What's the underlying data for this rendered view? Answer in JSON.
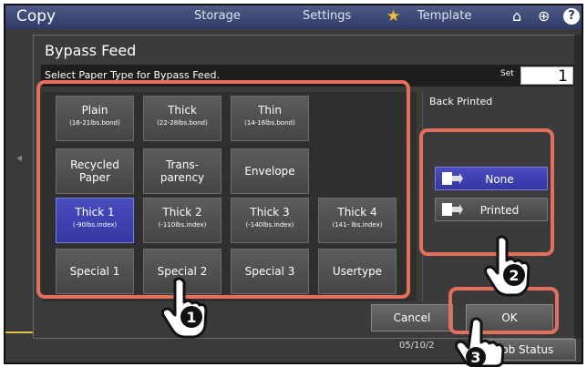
{
  "topbar": {
    "app_title": "Copy",
    "tabs": [
      "Storage",
      "Settings",
      "Template"
    ],
    "icons": [
      "star-icon",
      "home-icon",
      "globe-icon",
      "help-icon"
    ]
  },
  "dialog": {
    "title": "Bypass Feed",
    "message": "Select Paper Type for Bypass Feed.",
    "set_label": "Set",
    "set_value": "1"
  },
  "paper_types": [
    {
      "label": "Plain",
      "sub": "(16-21lbs.bond)"
    },
    {
      "label": "Thick",
      "sub": "(22-28lbs.bond)"
    },
    {
      "label": "Thin",
      "sub": "(14-16lbs.bond)"
    },
    {
      "label": "Recycled Paper",
      "sub": ""
    },
    {
      "label": "Trans-\nparency",
      "sub": ""
    },
    {
      "label": "Envelope",
      "sub": ""
    },
    {
      "label": "Thick 1",
      "sub": "(-90lbs.index)",
      "selected": true
    },
    {
      "label": "Thick 2",
      "sub": "(-110lbs.index)"
    },
    {
      "label": "Thick 3",
      "sub": "(-140lbs.index)"
    },
    {
      "label": "Thick 4",
      "sub": "(141- lbs.index)"
    },
    {
      "label": "Special 1",
      "sub": ""
    },
    {
      "label": "Special 2",
      "sub": ""
    },
    {
      "label": "Special 3",
      "sub": ""
    },
    {
      "label": "Usertype",
      "sub": ""
    }
  ],
  "back_printed": {
    "label": "Back Printed",
    "options": [
      {
        "label": "None",
        "selected": true
      },
      {
        "label": "Printed",
        "selected": false
      }
    ]
  },
  "buttons": {
    "cancel": "Cancel",
    "ok": "OK"
  },
  "status": {
    "datetime": "05/10/2",
    "job_status": "Job Status"
  },
  "callouts": [
    "1",
    "2",
    "3"
  ],
  "colors": {
    "highlight_outline": "#e36f5c",
    "selected_button": "#3e40b0",
    "topbar": "#3a4576"
  }
}
